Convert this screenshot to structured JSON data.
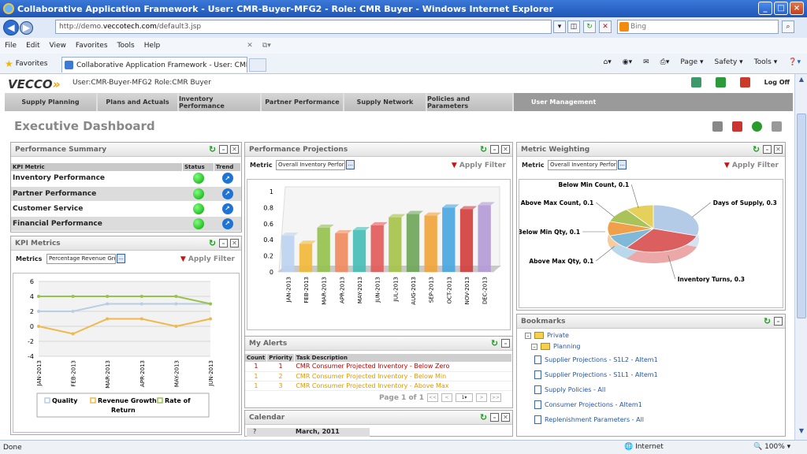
{
  "browser": {
    "title": "Collaborative Application Framework - User: CMR-Buyer-MFG2 - Role: CMR Buyer - Windows Internet Explorer",
    "url_prefix": "http://demo.",
    "url_host": "veccotech.com",
    "url_path": "/default3.jsp",
    "search_placeholder": "Bing",
    "menu": [
      "File",
      "Edit",
      "View",
      "Favorites",
      "Tools",
      "Help"
    ],
    "favorites_label": "Favorites",
    "tab_title": "Collaborative Application Framework - User: CMR-Buy...",
    "tools": [
      "Page ▾",
      "Safety ▾",
      "Tools ▾"
    ],
    "status_left": "Done",
    "status_zone": "Internet",
    "status_zoom": "100%"
  },
  "app": {
    "logo": "VECCO",
    "user_info": "User:CMR-Buyer-MFG2 Role:CMR Buyer",
    "logoff": "Log Off",
    "nav_tabs": [
      "Supply Planning",
      "Plans and Actuals",
      "Inventory Performance",
      "Partner Performance",
      "Supply Network",
      "Policies and Parameters",
      "User Management"
    ],
    "page_title": "Executive Dashboard"
  },
  "performance_summary": {
    "title": "Performance Summary",
    "headers": [
      "KPI Metric",
      "Status",
      "Trend"
    ],
    "rows": [
      "Inventory Performance",
      "Partner Performance",
      "Customer Service",
      "Financial Performance"
    ]
  },
  "kpi_metrics": {
    "title": "KPI Metrics",
    "metric_label": "Metrics",
    "metric_value": "Percentage Revenue Grow",
    "filter_label": "Apply Filter"
  },
  "performance_projections": {
    "title": "Performance Projections",
    "metric_label": "Metric",
    "metric_value": "Overall Inventory Perform",
    "filter_label": "Apply Filter"
  },
  "metric_weighting": {
    "title": "Metric Weighting",
    "metric_label": "Metric",
    "metric_value": "Overall Inventory Perform",
    "filter_label": "Apply Filter"
  },
  "my_alerts": {
    "title": "My Alerts",
    "headers": [
      "Count",
      "Priority",
      "Task Description"
    ],
    "rows": [
      {
        "count": "1",
        "priority": "1",
        "desc": "CMR Consumer Projected Inventory - Below Zero"
      },
      {
        "count": "1",
        "priority": "2",
        "desc": "CMR Consumer Projected Inventory - Below Min"
      },
      {
        "count": "1",
        "priority": "3",
        "desc": "CMR Consumer Projected Inventory - Above Max"
      }
    ],
    "pager_text": "Page 1 of 1",
    "pager_select": "1"
  },
  "calendar": {
    "title": "Calendar",
    "month": "March, 2011",
    "nav": "?"
  },
  "bookmarks": {
    "title": "Bookmarks",
    "root": "Private",
    "folder": "Planning",
    "items": [
      "Supplier Projections - S1L2 - AItem1",
      "Supplier Projections - S1L1 - AItem1",
      "Supply Policies - All",
      "Consumer Projections - AItem1",
      "Replenishment Parameters - All"
    ]
  },
  "colors": {
    "accent_green": "#07a307",
    "trend_blue": "#1e73d7",
    "alert_red": "#bb0000",
    "alert_orange": "#e09a00"
  },
  "chart_data": [
    {
      "type": "line",
      "categories": [
        "JAN-2013",
        "FEB-2013",
        "MAR-2013",
        "APR-2013",
        "MAY-2013",
        "JUN-2013"
      ],
      "ylim": [
        -4,
        6
      ],
      "yticks": [
        -4,
        -2,
        0,
        2,
        4,
        6
      ],
      "series": [
        {
          "name": "Quality",
          "values": [
            2,
            2,
            3,
            3,
            3,
            3
          ],
          "color": "#b9cde4"
        },
        {
          "name": "Revenue Growth",
          "values": [
            0,
            -1,
            1,
            1,
            0,
            1
          ],
          "color": "#f0b84a"
        },
        {
          "name": "Rate of Return",
          "values": [
            4,
            4,
            4,
            4,
            4,
            3
          ],
          "color": "#99c24d"
        }
      ],
      "legend": "bottom"
    },
    {
      "type": "bar",
      "categories": [
        "JAN-2013",
        "FEB-2013",
        "MAR-2013",
        "APR-2013",
        "MAY-2013",
        "JUN-2013",
        "JUL-2013",
        "AUG-2013",
        "SEP-2013",
        "OCT-2013",
        "NOV-2013",
        "DEC-2013"
      ],
      "values": [
        0.45,
        0.35,
        0.55,
        0.48,
        0.52,
        0.58,
        0.68,
        0.72,
        0.7,
        0.8,
        0.78,
        0.83
      ],
      "ylim": [
        0,
        1
      ],
      "yticks": [
        "0",
        "0.2",
        "0.4",
        "0.6",
        "0.8",
        "1"
      ],
      "colors": [
        "#bcd2ef",
        "#f1b93a",
        "#95c24e",
        "#f08a5e",
        "#48bdb6",
        "#e25b5b",
        "#a7c24b",
        "#6fa75a",
        "#f1a43b",
        "#4aa6e0",
        "#d24040",
        "#b39bd6"
      ]
    },
    {
      "type": "pie",
      "slices": [
        {
          "label": "Days of Supply, 0.3",
          "value": 0.3,
          "color": "#b4cbe8"
        },
        {
          "label": "Inventory Turns, 0.3",
          "value": 0.3,
          "color": "#dc5f5f"
        },
        {
          "label": "Above Max Qty, 0.1",
          "value": 0.1,
          "color": "#7fb8d9"
        },
        {
          "label": "Below Min Qty, 0.1",
          "value": 0.1,
          "color": "#f0a04a"
        },
        {
          "label": "Above Max Count, 0.1",
          "value": 0.1,
          "color": "#a9c35a"
        },
        {
          "label": "Below Min Count, 0.1",
          "value": 0.1,
          "color": "#e4d05a"
        }
      ]
    }
  ]
}
